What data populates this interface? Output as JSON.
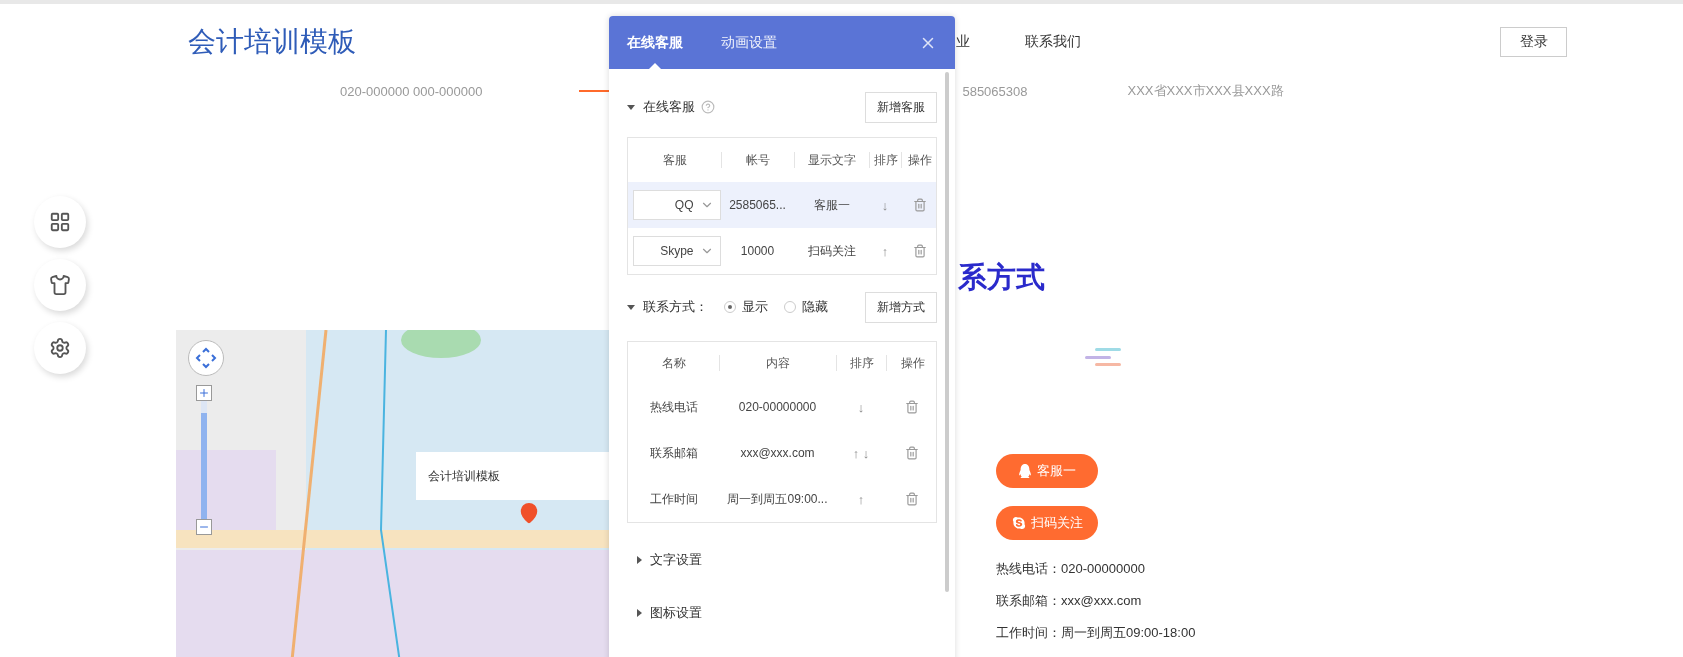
{
  "header": {
    "logo": "会计培训模板",
    "nav": [
      "业",
      "联系我们"
    ],
    "login": "登录"
  },
  "subheader": {
    "items": [
      "020-000000 000-000000",
      "585065308",
      "XXX省XXX市XXX县XXX路"
    ]
  },
  "side_tools": [
    {
      "kind": "grid"
    },
    {
      "kind": "shirt"
    },
    {
      "kind": "settings"
    }
  ],
  "contact": {
    "title": "系方式",
    "map": {
      "popup": "会计培训模板",
      "zoom": {
        "level": 0.9
      }
    },
    "buttons": [
      {
        "kind": "qq",
        "label": "客服一"
      },
      {
        "kind": "skype",
        "label": "扫码关注"
      }
    ],
    "lines": [
      "热线电话：020-00000000",
      "联系邮箱：xxx@xxx.com",
      "工作时间：周一到周五09:00-18:00"
    ]
  },
  "panel": {
    "tabs": [
      {
        "label": "在线客服",
        "selected": true
      },
      {
        "label": "动画设置",
        "selected": false
      }
    ],
    "service": {
      "title": "在线客服",
      "expanded": true,
      "add_button": "新增客服",
      "columns": [
        "客服",
        "帐号",
        "显示文字",
        "排序",
        "操作"
      ],
      "rows": [
        {
          "type": "QQ",
          "account": "2585065...",
          "text": "客服一",
          "sort": "↓",
          "selected": true
        },
        {
          "type": "Skype",
          "account": "10000",
          "text": "扫码关注",
          "sort": "↑",
          "selected": false
        }
      ]
    },
    "contact": {
      "title": "联系方式：",
      "expanded": true,
      "options": [
        {
          "label": "显示",
          "selected": true
        },
        {
          "label": "隐藏",
          "selected": false
        }
      ],
      "add_button": "新增方式",
      "columns": [
        "名称",
        "内容",
        "排序",
        "操作"
      ],
      "rows": [
        {
          "name": "热线电话",
          "content": "020-00000000",
          "sort": "↓"
        },
        {
          "name": "联系邮箱",
          "content": "xxx@xxx.com",
          "sort": "↑ ↓"
        },
        {
          "name": "工作时间",
          "content": "周一到周五09:00...",
          "sort": "↑"
        }
      ]
    },
    "sections": [
      {
        "title": "文字设置",
        "expanded": false
      },
      {
        "title": "图标设置",
        "expanded": false
      }
    ]
  }
}
